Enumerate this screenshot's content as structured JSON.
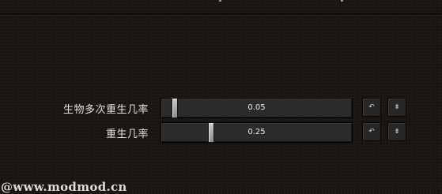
{
  "settings": [
    {
      "label": "生物多次重生几率",
      "value": "0.05",
      "fraction": 0.05,
      "undo_icon": "↶",
      "default_icon": "⇟"
    },
    {
      "label": "重生几率",
      "value": "0.25",
      "fraction": 0.25,
      "undo_icon": "↶",
      "default_icon": "⇟"
    }
  ],
  "icons": {
    "undo": "undo-icon",
    "reset_default": "reset-default-icon"
  },
  "watermark": "@www.modmod.cn"
}
